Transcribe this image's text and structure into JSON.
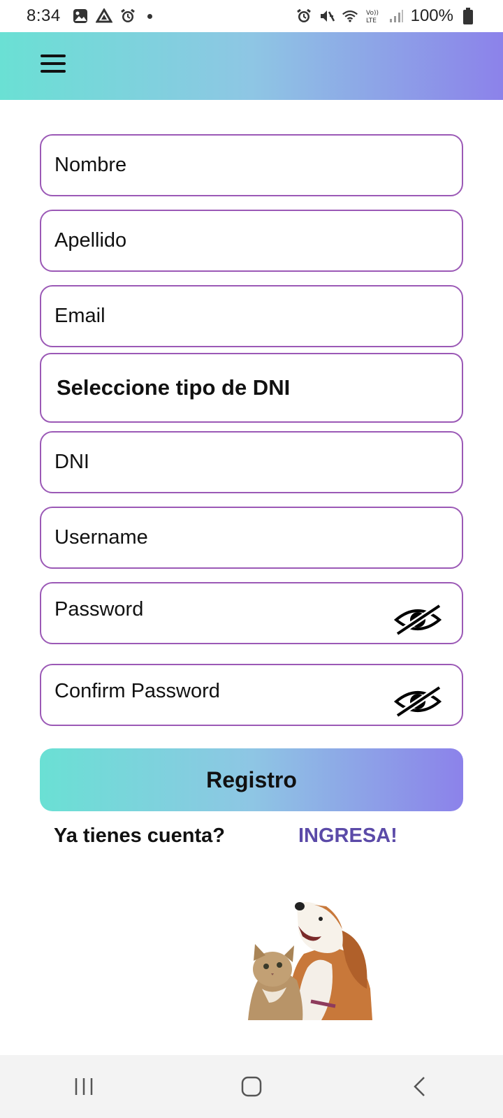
{
  "status_bar": {
    "time": "8:34",
    "battery": "100%",
    "left_icons": [
      "image-icon",
      "drive-icon",
      "alarm-icon",
      "notification-dot"
    ],
    "right_icons": [
      "alarm-icon",
      "mute-icon",
      "wifi-icon",
      "volte-icon",
      "signal-icon",
      "battery-icon"
    ]
  },
  "header": {
    "menu_icon": "hamburger-menu-icon",
    "gradient": [
      "#6ae0d4",
      "#8ec6e4",
      "#8c82ea"
    ]
  },
  "form": {
    "nombre_placeholder": "Nombre",
    "apellido_placeholder": "Apellido",
    "email_placeholder": "Email",
    "dni_type_label": "Seleccione tipo de DNI",
    "dni_placeholder": "DNI",
    "username_placeholder": "Username",
    "password_placeholder": "Password",
    "confirm_password_placeholder": "Confirm Password",
    "border_color": "#9b59b6"
  },
  "actions": {
    "register_label": "Registro",
    "have_account_text": "Ya tienes cuenta?",
    "login_link_label": "INGRESA!",
    "link_color": "#5b4aa8"
  },
  "nav": {
    "recents_icon": "recents-icon",
    "home_icon": "home-icon",
    "back_icon": "back-icon"
  }
}
